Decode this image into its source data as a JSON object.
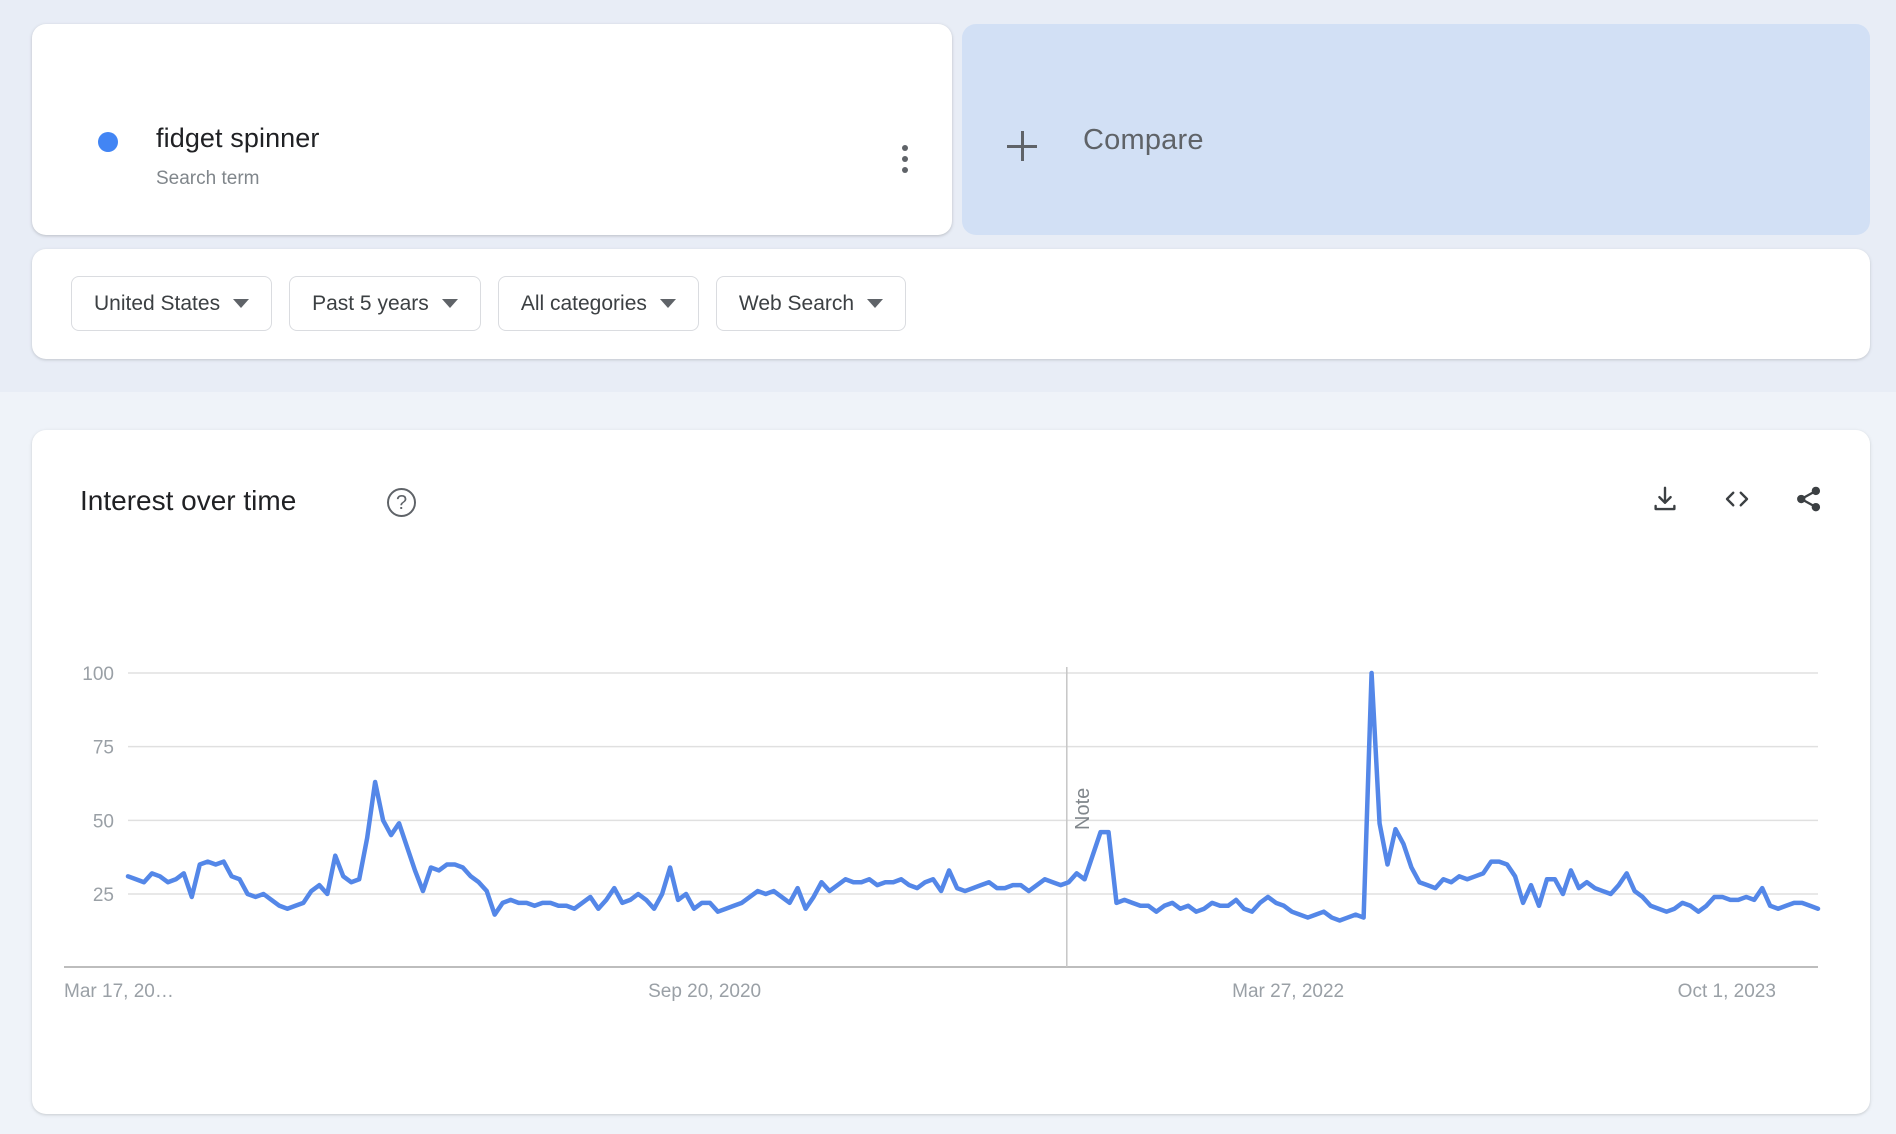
{
  "query_card": {
    "term": "fidget spinner",
    "subtitle": "Search term",
    "menu_icon": "kebab-menu-icon",
    "dot_color": "#4285f4"
  },
  "compare_card": {
    "label": "Compare",
    "plus_icon": "plus-icon",
    "background": "#d2e0f5"
  },
  "filters": [
    {
      "label": "United States",
      "name": "location"
    },
    {
      "label": "Past 5 years",
      "name": "time-range"
    },
    {
      "label": "All categories",
      "name": "category"
    },
    {
      "label": "Web Search",
      "name": "search-type"
    }
  ],
  "chart_card": {
    "title": "Interest over time",
    "help_icon": "help-circle-icon",
    "tools": [
      {
        "name": "download-icon",
        "label": "Download"
      },
      {
        "name": "embed-code-icon",
        "label": "Embed"
      },
      {
        "name": "share-icon",
        "label": "Share"
      }
    ]
  },
  "chart_data": {
    "type": "line",
    "title": "Interest over time",
    "xlabel": "",
    "ylabel": "",
    "ylim": [
      0,
      105
    ],
    "yticks": [
      25,
      50,
      75,
      100
    ],
    "ytick_labels": [
      "25",
      "50",
      "75",
      "100"
    ],
    "grid": true,
    "legend": false,
    "series_name": "fidget spinner",
    "series_color": "#5487e8",
    "xtick_labels": [
      "Mar 17, 20…",
      "Sep 20, 2020",
      "Mar 27, 2022",
      "Oct 1, 2023"
    ],
    "xtick_positions": [
      0,
      0.333,
      0.666,
      0.92
    ],
    "annotations": [
      {
        "label": "Note",
        "x_fraction": 0.5555,
        "orientation": "vertical",
        "line": true
      }
    ],
    "values": [
      31,
      30,
      29,
      32,
      31,
      29,
      30,
      32,
      24,
      35,
      36,
      35,
      36,
      31,
      30,
      25,
      24,
      25,
      23,
      21,
      20,
      21,
      22,
      26,
      28,
      25,
      38,
      31,
      29,
      30,
      44,
      63,
      50,
      45,
      49,
      41,
      33,
      26,
      34,
      33,
      35,
      35,
      34,
      31,
      29,
      26,
      18,
      22,
      23,
      22,
      22,
      21,
      22,
      22,
      21,
      21,
      20,
      22,
      24,
      20,
      23,
      27,
      22,
      23,
      25,
      23,
      20,
      25,
      34,
      23,
      25,
      20,
      22,
      22,
      19,
      20,
      21,
      22,
      24,
      26,
      25,
      26,
      24,
      22,
      27,
      20,
      24,
      29,
      26,
      28,
      30,
      29,
      29,
      30,
      28,
      29,
      29,
      30,
      28,
      27,
      29,
      30,
      26,
      33,
      27,
      26,
      27,
      28,
      29,
      27,
      27,
      28,
      28,
      26,
      28,
      30,
      29,
      28,
      29,
      32,
      30,
      38,
      46,
      46,
      22,
      23,
      22,
      21,
      21,
      19,
      21,
      22,
      20,
      21,
      19,
      20,
      22,
      21,
      21,
      23,
      20,
      19,
      22,
      24,
      22,
      21,
      19,
      18,
      17,
      18,
      19,
      17,
      16,
      17,
      18,
      17,
      100,
      49,
      35,
      47,
      42,
      34,
      29,
      28,
      27,
      30,
      29,
      31,
      30,
      31,
      32,
      36,
      36,
      35,
      31,
      22,
      28,
      21,
      30,
      30,
      25,
      33,
      27,
      29,
      27,
      26,
      25,
      28,
      32,
      26,
      24,
      21,
      20,
      19,
      20,
      22,
      21,
      19,
      21,
      24,
      24,
      23,
      23,
      24,
      23,
      27,
      21,
      20,
      21,
      22,
      22,
      21,
      20
    ],
    "value_max": 100,
    "value_min": 16,
    "point_count": 215
  }
}
